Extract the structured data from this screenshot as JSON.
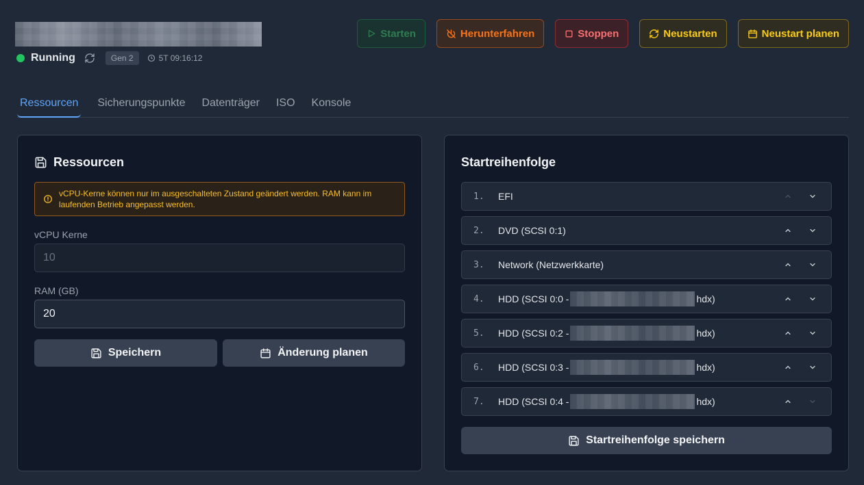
{
  "header": {
    "status": "Running",
    "generation": "Gen 2",
    "uptime": "5T 09:16:12"
  },
  "actions": {
    "start": "Starten",
    "shutdown": "Herunterfahren",
    "stop": "Stoppen",
    "restart": "Neustarten",
    "schedule_restart": "Neustart planen"
  },
  "tabs": [
    "Ressourcen",
    "Sicherungspunkte",
    "Datenträger",
    "ISO",
    "Konsole"
  ],
  "resources": {
    "title": "Ressourcen",
    "warning": "vCPU-Kerne können nur im ausgeschalteten Zustand geändert werden. RAM kann im laufenden Betrieb angepasst werden.",
    "vcpu_label": "vCPU Kerne",
    "vcpu_value": "10",
    "ram_label": "RAM (GB)",
    "ram_value": "20",
    "save": "Speichern",
    "schedule_change": "Änderung planen"
  },
  "boot_order": {
    "title": "Startreihenfolge",
    "items": [
      {
        "num": "1.",
        "label": "EFI"
      },
      {
        "num": "2.",
        "label": "DVD (SCSI 0:1)"
      },
      {
        "num": "3.",
        "label": "Network (Netzwerkkarte)"
      },
      {
        "num": "4.",
        "prefix": "HDD (SCSI 0:0 -",
        "suffix": "hdx)"
      },
      {
        "num": "5.",
        "prefix": "HDD (SCSI 0:2 -",
        "suffix": "hdx)"
      },
      {
        "num": "6.",
        "prefix": "HDD (SCSI 0:3 -",
        "suffix": "hdx)"
      },
      {
        "num": "7.",
        "prefix": "HDD (SCSI 0:4 -",
        "suffix": "hdx)"
      }
    ],
    "save": "Startreihenfolge speichern"
  }
}
